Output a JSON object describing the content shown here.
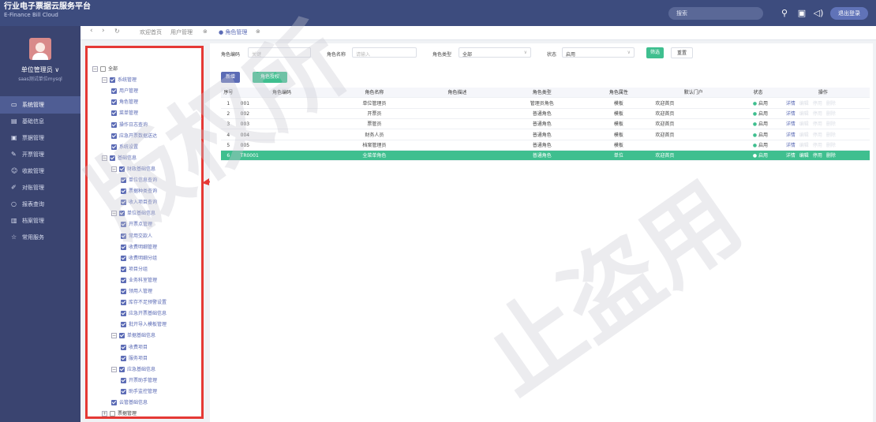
{
  "header": {
    "title": "行业电子票据云服务平台",
    "subtitle": "E-Finance Bill Cloud",
    "search_placeholder": "搜索",
    "logout": "退出登录",
    "icons": [
      "search-icon",
      "layout-icon",
      "sound-icon"
    ]
  },
  "user": {
    "name": "单位管理员 ∨",
    "org": "saas测试单位mysql"
  },
  "sidebar": {
    "items": [
      {
        "label": "系统管理",
        "icon": "monitor-icon",
        "active": true
      },
      {
        "label": "基础信息",
        "icon": "book-icon"
      },
      {
        "label": "票据管理",
        "icon": "ticket-icon"
      },
      {
        "label": "开票管理",
        "icon": "edit-icon"
      },
      {
        "label": "收款管理",
        "icon": "people-icon"
      },
      {
        "label": "对账管理",
        "icon": "pen-icon"
      },
      {
        "label": "报表查询",
        "icon": "search-icon"
      },
      {
        "label": "档案管理",
        "icon": "file-icon"
      },
      {
        "label": "常用服务",
        "icon": "star-icon"
      }
    ]
  },
  "tabs": {
    "nav": [
      "‹",
      "›",
      "↻"
    ],
    "items": [
      "欢迎首页",
      "用户管理",
      "角色管理"
    ],
    "close": "⊗"
  },
  "tree": [
    {
      "label": "全部",
      "level": 0,
      "toggle": "−",
      "check": "empty",
      "plain": true
    },
    {
      "label": "系统管理",
      "level": 1,
      "toggle": "−"
    },
    {
      "label": "用户管理",
      "level": 2
    },
    {
      "label": "角色管理",
      "level": 2
    },
    {
      "label": "菜单管理",
      "level": 2
    },
    {
      "label": "操作日志查询",
      "level": 2
    },
    {
      "label": "应急开票数据送达",
      "level": 2
    },
    {
      "label": "系统设置",
      "level": 2
    },
    {
      "label": "基础信息",
      "level": 1,
      "toggle": "−"
    },
    {
      "label": "财政基础信息",
      "level": 2,
      "toggle": "−"
    },
    {
      "label": "单位信息查询",
      "level": 3
    },
    {
      "label": "票据种类查询",
      "level": 3
    },
    {
      "label": "收入项目查询",
      "level": 3
    },
    {
      "label": "单位基础信息",
      "level": 2,
      "toggle": "−"
    },
    {
      "label": "开票点管理",
      "level": 3
    },
    {
      "label": "常用交款人",
      "level": 3
    },
    {
      "label": "收费明细管理",
      "level": 3
    },
    {
      "label": "收费明细分组",
      "level": 3
    },
    {
      "label": "项目分组",
      "level": 3
    },
    {
      "label": "业务科室管理",
      "level": 3
    },
    {
      "label": "领用人管理",
      "level": 3
    },
    {
      "label": "库存不足预警设置",
      "level": 3
    },
    {
      "label": "应急开票基础信息",
      "level": 3
    },
    {
      "label": "批开导入模板管理",
      "level": 3
    },
    {
      "label": "单据基础信息",
      "level": 2,
      "toggle": "−"
    },
    {
      "label": "收费项目",
      "level": 3
    },
    {
      "label": "服务项目",
      "level": 3
    },
    {
      "label": "应急基础信息",
      "level": 2,
      "toggle": "−"
    },
    {
      "label": "开票助手管理",
      "level": 3
    },
    {
      "label": "助手监控管理",
      "level": 3
    },
    {
      "label": "云管基础信息",
      "level": 2
    },
    {
      "label": "票据管理",
      "level": 1,
      "toggle": "+",
      "check": "empty",
      "plain": true
    }
  ],
  "filters": {
    "code_label": "角色编码",
    "code_placeholder": "关键",
    "name_label": "角色名称",
    "name_placeholder": "请输入",
    "type_label": "角色类型",
    "type_value": "全部",
    "status_label": "状态",
    "status_value": "启用",
    "search": "筛选",
    "reset": "重置"
  },
  "actions": {
    "add": "新增",
    "authorize": "角色授权"
  },
  "table": {
    "headers": [
      "序号",
      "角色编码",
      "角色名称",
      "角色描述",
      "角色类型",
      "角色属性",
      "默认门户",
      "状态",
      "操作"
    ],
    "rows": [
      {
        "no": "1",
        "code": "001",
        "name": "单位管理员",
        "desc": "",
        "type": "管理员角色",
        "attr": "模板",
        "portal": "欢迎首页",
        "status": "启用"
      },
      {
        "no": "2",
        "code": "002",
        "name": "开票员",
        "desc": "",
        "type": "普通角色",
        "attr": "模板",
        "portal": "欢迎首页",
        "status": "启用"
      },
      {
        "no": "3",
        "code": "003",
        "name": "票管员",
        "desc": "",
        "type": "普通角色",
        "attr": "模板",
        "portal": "欢迎首页",
        "status": "启用"
      },
      {
        "no": "4",
        "code": "004",
        "name": "财务人员",
        "desc": "",
        "type": "普通角色",
        "attr": "模板",
        "portal": "欢迎首页",
        "status": "启用"
      },
      {
        "no": "5",
        "code": "005",
        "name": "档案管理员",
        "desc": "",
        "type": "普通角色",
        "attr": "模板",
        "portal": "",
        "status": "启用"
      },
      {
        "no": "6",
        "code": "TR0001",
        "name": "全菜单角色",
        "desc": "",
        "type": "普通角色",
        "attr": "单位",
        "portal": "欢迎首页",
        "status": "启用",
        "selected": true
      }
    ],
    "row_actions": [
      "详情",
      "编辑",
      "停用",
      "删除"
    ]
  },
  "watermark": [
    "版权所",
    "止盗用"
  ],
  "colors": {
    "header": "#3d4c7e",
    "sidebar": "#3a4470",
    "primary": "#5b6bb5",
    "success": "#3fbf8f",
    "highlight": "#e53935"
  }
}
